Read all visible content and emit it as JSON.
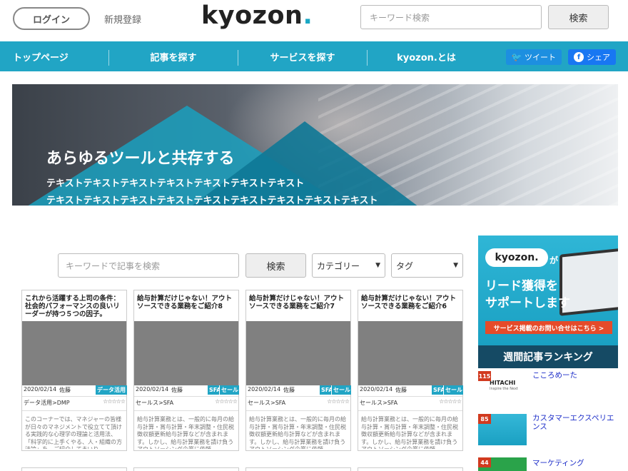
{
  "header": {
    "login_label": "ログイン",
    "register_label": "新規登録",
    "logo_text": "kyozon",
    "logo_dot": ".",
    "search_placeholder": "キーワード検索",
    "search_button": "検索"
  },
  "nav": {
    "items": [
      "トップページ",
      "記事を探す",
      "サービスを探す",
      "kyozon.とは"
    ],
    "tweet_label": "ツイート",
    "share_label": "シェア"
  },
  "hero": {
    "title": "あらゆるツールと共存する",
    "line1": "テキストテキストテキストテキストテキストテキストテキスト",
    "line2": "テキストテキストテキストテキストテキストテキストテキストテキストテキスト"
  },
  "filter": {
    "search_placeholder": "キーワードで記事を検索",
    "search_button": "検索",
    "category_label": "カテゴリー",
    "tag_label": "タグ"
  },
  "cards": [
    {
      "title": "これから活躍する上司の条件：社会的パフォーマンスの良いリーダーが持つ５つの因子。",
      "date": "2020/02/14",
      "author": "佐藤",
      "tags": [
        "データ活用"
      ],
      "category": "データ活用>DMP",
      "stars": "☆☆☆☆☆",
      "description": "このコーナーでは、マネジャーの皆様が日々のマネジメントで役立てて頂ける実践的な心理学の理論と活用法、「科学的に上手くやる、人・組織の方法論」を、ご紹介してまいり"
    },
    {
      "title": "給与計算だけじゃない！アウトソースできる業務をご紹介8",
      "date": "2020/02/14",
      "author": "佐藤",
      "tags": [
        "SFA",
        "セール"
      ],
      "category": "セールス>SFA",
      "stars": "☆☆☆☆☆",
      "description": "給与計算業務とは、一般的に毎月の給与計算・賞与計算・年末調整・住民税徴収額更新給与計算などが含まれます。しかし、給与計算業務を請け負うアウトソーシング企業に依頼"
    },
    {
      "title": "給与計算だけじゃない！アウトソースできる業務をご紹介7",
      "date": "2020/02/14",
      "author": "佐藤",
      "tags": [
        "SFA",
        "セール"
      ],
      "category": "セールス>SFA",
      "stars": "☆☆☆☆☆",
      "description": "給与計算業務とは、一般的に毎月の給与計算・賞与計算・年末調整・住民税徴収額更新給与計算などが含まれます。しかし、給与計算業務を請け負うアウトソーシング企業に依頼"
    },
    {
      "title": "給与計算だけじゃない！アウトソースできる業務をご紹介6",
      "date": "2020/02/14",
      "author": "佐藤",
      "tags": [
        "SFA",
        "セール"
      ],
      "category": "セールス>SFA",
      "stars": "☆☆☆☆☆",
      "description": "給与計算業務とは、一般的に毎月の給与計算・賞与計算・年末調整・住民税徴収額更新給与計算などが含まれます。しかし、給与計算業務を請け負うアウトソーシング企業に依頼"
    }
  ],
  "sidebar": {
    "ad": {
      "logo": "kyozon.",
      "ga": "が",
      "line1": "リード獲得を",
      "line2": "サポートします",
      "cta": "サービス掲載のお問い合せはこちら >"
    },
    "ranking_title": "週間記事ランキング",
    "ranking": [
      {
        "num": "115",
        "title": "こころめーた",
        "thumb_text": "HITACHI",
        "thumb_sub": "Inspire the Next"
      },
      {
        "num": "85",
        "title": "カスタマーエクスペリエンス"
      },
      {
        "num": "44",
        "title": "マーケティング"
      }
    ]
  },
  "colors": {
    "accent": "#21a5c5",
    "nav_bg": "#21a5c5",
    "ranking_bg": "#154a64",
    "twitter": "#1d8fe0",
    "facebook": "#1877f2",
    "cta": "#e54b2a"
  }
}
